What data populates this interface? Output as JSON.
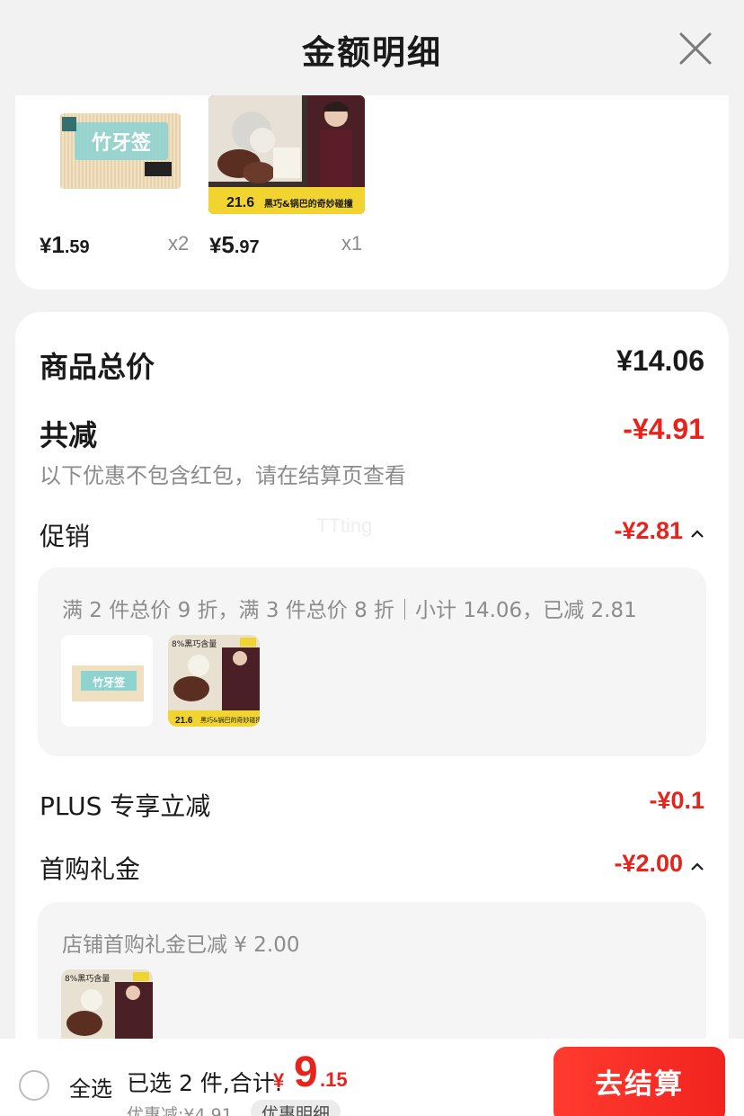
{
  "header": {
    "title": "金额明细",
    "close_icon": "close-icon"
  },
  "products": [
    {
      "price_yen": "¥",
      "price_int": "1",
      "price_dec": ".59",
      "qty": "x2",
      "image": "toothpick-package"
    },
    {
      "price_yen": "¥",
      "price_int": "5",
      "price_dec": ".97",
      "qty": "x1",
      "image": "snack-package",
      "badge_value": "21.6",
      "badge_text": "黑巧&锅巴的奇妙碰撞"
    }
  ],
  "summary": {
    "goods_total_label": "商品总价",
    "goods_total_value": "¥14.06",
    "total_reduce_label": "共减",
    "total_reduce_value": "-¥4.91",
    "note": "以下优惠不包含红包，请在结算页查看",
    "promo_label": "促销",
    "promo_value": "-¥2.81",
    "promo_detail": "满 2 件总价 9 折，满 3 件总价 8 折｜小计 14.06，已减 2.81",
    "plus_label": "PLUS 专享立减",
    "plus_value": "-¥0.1",
    "first_gift_label": "首购礼金",
    "first_gift_value": "-¥2.00",
    "first_gift_detail": "店铺首购礼金已减 ¥ 2.00",
    "watermark": "TTting"
  },
  "thumbs": {
    "snack_top_label": "8%黑巧含量",
    "snack_badge": "21.6",
    "snack_slogan": "黑巧&锅巴的奇妙碰撞"
  },
  "bottom_bar": {
    "select_all": "全选",
    "selected_text": "已选 2 件,合计:",
    "total_yen": "¥",
    "total_int": "9",
    "total_dec": ".15",
    "discount_line": "优惠减:¥4.91",
    "detail_chip": "优惠明细",
    "checkout": "去结算"
  },
  "colors": {
    "accent_red": "#e8231b",
    "bg": "#f2f2f2",
    "card": "#ffffff"
  }
}
